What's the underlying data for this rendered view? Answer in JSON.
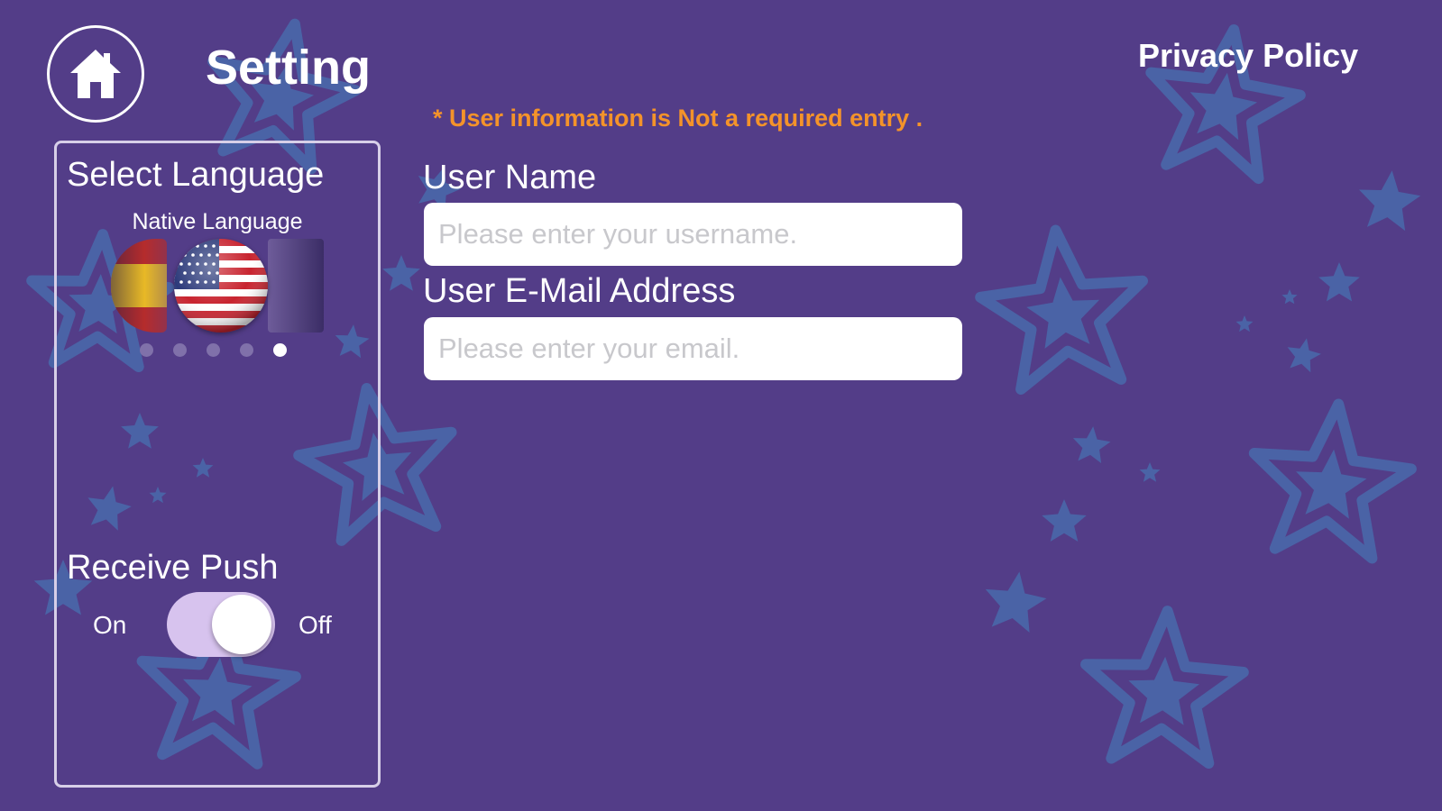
{
  "header": {
    "title": "Setting",
    "privacy_link": "Privacy Policy",
    "home_icon": "home-icon"
  },
  "notice": "* User information is Not a required entry .",
  "language_panel": {
    "heading": "Select Language",
    "native_label": "Native Language",
    "flags": [
      "spain-flag-icon",
      "us-flag-icon",
      "blank-flag"
    ],
    "pager": {
      "count": 5,
      "active_index": 4
    }
  },
  "push": {
    "heading": "Receive Push",
    "on_label": "On",
    "off_label": "Off",
    "state": "off"
  },
  "form": {
    "username": {
      "label": "User Name",
      "value": "",
      "placeholder": "Please enter your username."
    },
    "email": {
      "label": "User E-Mail Address",
      "value": "",
      "placeholder": "Please enter your email."
    }
  },
  "colors": {
    "background": "#533d88",
    "star": "#4a63a6",
    "notice": "#f4932a",
    "toggle_track": "#d7c3ee"
  }
}
